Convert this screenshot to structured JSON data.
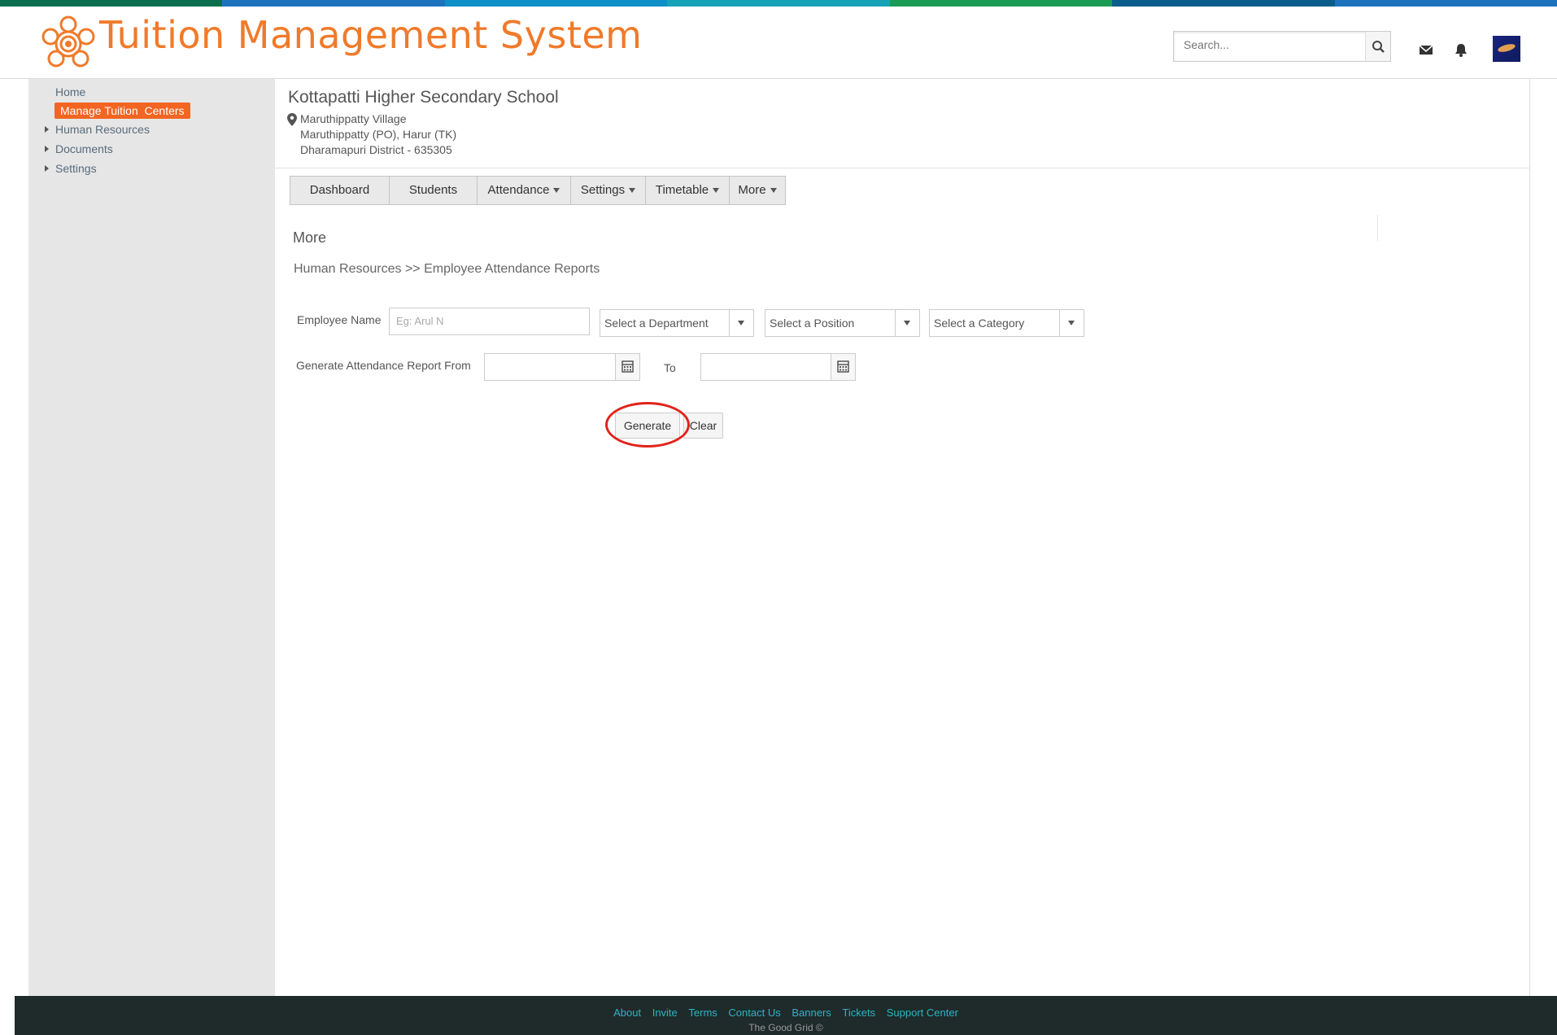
{
  "colors": {
    "brand_orange": "#f07a2a",
    "active_bg": "#f26522",
    "footer_bg": "#1f2a2a",
    "footer_link": "#2bb5c5",
    "highlight_circle": "#e2231a",
    "stripe": [
      "#0b6e4f",
      "#1e73be",
      "#0f8fc7",
      "#17a2b8",
      "#1a9c54",
      "#1e8449",
      "#0a5c8a"
    ]
  },
  "header": {
    "title": "Tuition Management System",
    "search_placeholder": "Search...",
    "icons": [
      "search-icon",
      "mail-icon",
      "bell-icon",
      "avatar"
    ]
  },
  "sidebar": {
    "home": "Home",
    "active": "Manage Tuition  Centers",
    "items": [
      {
        "label": "Human Resources"
      },
      {
        "label": "Documents"
      },
      {
        "label": "Settings"
      }
    ]
  },
  "school": {
    "name": "Kottapatti Higher Secondary School",
    "address": [
      "Maruthippatty Village",
      "Maruthippatty (PO), Harur (TK)",
      "Dharamapuri District - 635305"
    ]
  },
  "tabs": [
    {
      "label": "Dashboard",
      "dropdown": false
    },
    {
      "label": "Students",
      "dropdown": false
    },
    {
      "label": "Attendance",
      "dropdown": true
    },
    {
      "label": "Settings",
      "dropdown": true
    },
    {
      "label": "Timetable",
      "dropdown": true
    },
    {
      "label": "More",
      "dropdown": true
    }
  ],
  "page": {
    "section_title": "More",
    "breadcrumb": "Human Resources >> Employee Attendance Reports"
  },
  "form": {
    "employee_name_label": "Employee Name",
    "employee_name_placeholder": "Eg: Arul N",
    "department": "Select a Department",
    "position": "Select a Position",
    "category": "Select a Category",
    "report_from_label": "Generate Attendance Report From",
    "to_label": "To",
    "generate": "Generate",
    "clear": "Clear"
  },
  "footer": {
    "links": [
      "About",
      "Invite",
      "Terms",
      "Contact Us",
      "Banners",
      "Tickets",
      "Support Center"
    ],
    "copyright": "The Good Grid ©"
  }
}
